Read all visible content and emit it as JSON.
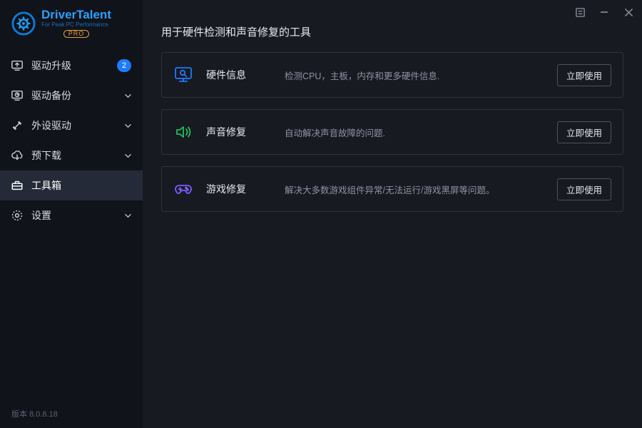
{
  "app": {
    "title_part1": "Driver",
    "title_part2": "Talent",
    "subtitle": "For Peak PC Performance",
    "pro": "PRO"
  },
  "sidebar": {
    "items": [
      {
        "label": "驱动升级",
        "badge": "2"
      },
      {
        "label": "驱动备份"
      },
      {
        "label": "外设驱动"
      },
      {
        "label": "预下载"
      },
      {
        "label": "工具箱"
      },
      {
        "label": "设置"
      }
    ],
    "version_prefix": "版本",
    "version": "8.0.8.18"
  },
  "main": {
    "page_title": "用于硬件检测和声音修复的工具",
    "tools": [
      {
        "name": "硬件信息",
        "desc": "检测CPU，主板，内存和更多硬件信息.",
        "button": "立即使用"
      },
      {
        "name": "声音修复",
        "desc": "自动解决声音故障的问题.",
        "button": "立即使用"
      },
      {
        "name": "游戏修复",
        "desc": "解决大多数游戏组件异常/无法运行/游戏黑屏等问题。",
        "button": "立即使用"
      }
    ]
  }
}
